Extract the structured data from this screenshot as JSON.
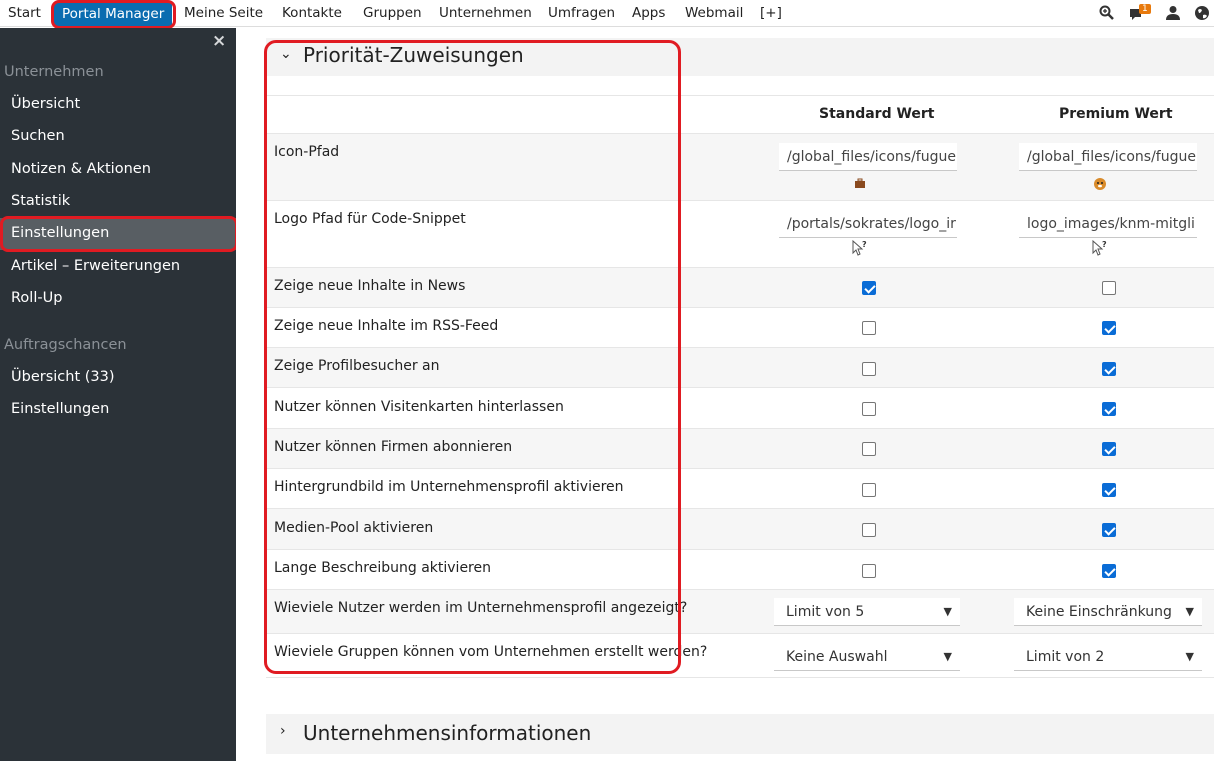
{
  "topnav": {
    "items": [
      "Start",
      "Portal Manager",
      "Meine Seite",
      "Kontakte",
      "Gruppen",
      "Unternehmen",
      "Umfragen",
      "Apps",
      "Webmail",
      "[+]"
    ],
    "active": "Portal Manager",
    "notification_count": "1",
    "icons": [
      "search-icon",
      "chat-icon",
      "user-icon",
      "globe-icon"
    ],
    "accent_color": "#0a6cb0"
  },
  "sidebar": {
    "close": "×",
    "sections": [
      {
        "heading": "Unternehmen",
        "items": [
          "Übersicht",
          "Suchen",
          "Notizen & Aktionen",
          "Statistik",
          "Einstellungen",
          "Artikel – Erweiterungen",
          "Roll-Up"
        ]
      },
      {
        "heading": "Auftragschancen",
        "items": [
          "Übersicht (33)",
          "Einstellungen"
        ]
      }
    ],
    "active_item": "Einstellungen"
  },
  "main": {
    "panel1": {
      "title": "Priorität-Zuweisungen",
      "col_standard": "Standard Wert",
      "col_premium": "Premium Wert",
      "rows": [
        {
          "label": "Icon-Pfad",
          "standard": "/global_files/icons/fugue",
          "premium": "/global_files/icons/fugue"
        },
        {
          "label": "Logo Pfad für Code-Snippet",
          "standard": "/portals/sokrates/logo_ir",
          "premium": "logo_images/knm-mitgli"
        },
        {
          "label": "Zeige neue Inhalte in News",
          "standard": true,
          "premium": false
        },
        {
          "label": "Zeige neue Inhalte im RSS-Feed",
          "standard": false,
          "premium": true
        },
        {
          "label": "Zeige Profilbesucher an",
          "standard": false,
          "premium": true
        },
        {
          "label": "Nutzer können Visitenkarten hinterlassen",
          "standard": false,
          "premium": true
        },
        {
          "label": "Nutzer können Firmen abonnieren",
          "standard": false,
          "premium": true
        },
        {
          "label": "Hintergrundbild im Unternehmensprofil aktivieren",
          "standard": false,
          "premium": true
        },
        {
          "label": "Medien-Pool aktivieren",
          "standard": false,
          "premium": true
        },
        {
          "label": "Lange Beschreibung aktivieren",
          "standard": false,
          "premium": true
        },
        {
          "label": "Wieviele Nutzer werden im Unternehmensprofil angezeigt?",
          "standard": "Limit von 5",
          "premium": "Keine Einschränkung"
        },
        {
          "label": "Wieviele Gruppen können vom Unternehmen erstellt werden?",
          "standard": "Keine Auswahl",
          "premium": "Limit von 2"
        }
      ]
    },
    "panel2": {
      "title": "Unternehmensinformationen"
    }
  }
}
